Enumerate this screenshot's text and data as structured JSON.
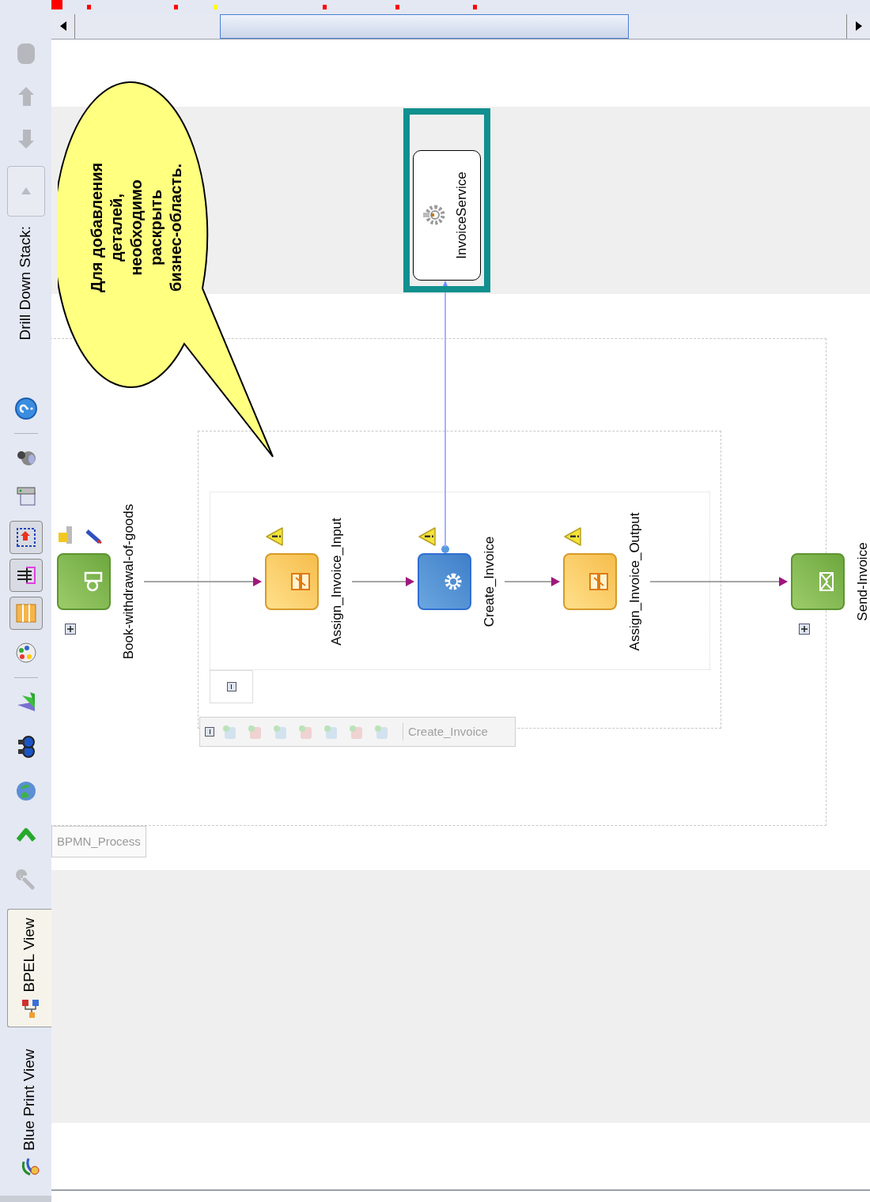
{
  "toolbar": {
    "tabs": [
      {
        "label": "Blue Print View",
        "selected": false
      },
      {
        "label": "BPEL View",
        "selected": true
      }
    ],
    "drill_down_label": "Drill Down Stack:"
  },
  "overview_markers": [
    {
      "color": "#ff0000"
    },
    {
      "color": "#ff0000"
    },
    {
      "color": "#ff0000"
    },
    {
      "color": "#ffff00"
    },
    {
      "color": "#ff0000"
    },
    {
      "color": "#ff0000"
    },
    {
      "color": "#ff0000"
    }
  ],
  "diagram": {
    "process_label": "BPMN_Process",
    "scope_label": "Create_Invoice",
    "activities": [
      {
        "label": "Book-withdrawal-of-goods",
        "kind": "receive",
        "warning": false,
        "expandable": true
      },
      {
        "label": "Assign_Invoice_Input",
        "kind": "assign",
        "warning": true,
        "expandable": false
      },
      {
        "label": "Create_Invoice",
        "kind": "invoke",
        "warning": true,
        "expandable": false
      },
      {
        "label": "Assign_Invoice_Output",
        "kind": "assign",
        "warning": true,
        "expandable": false
      },
      {
        "label": "Send-Invoice",
        "kind": "send",
        "warning": false,
        "expandable": true
      }
    ],
    "service": {
      "label": "InvoiceService",
      "selected": true
    },
    "callout": {
      "lines": [
        "Для добавления",
        "деталей,",
        "необходимо",
        "раскрыть",
        "бизнес-область."
      ]
    }
  }
}
